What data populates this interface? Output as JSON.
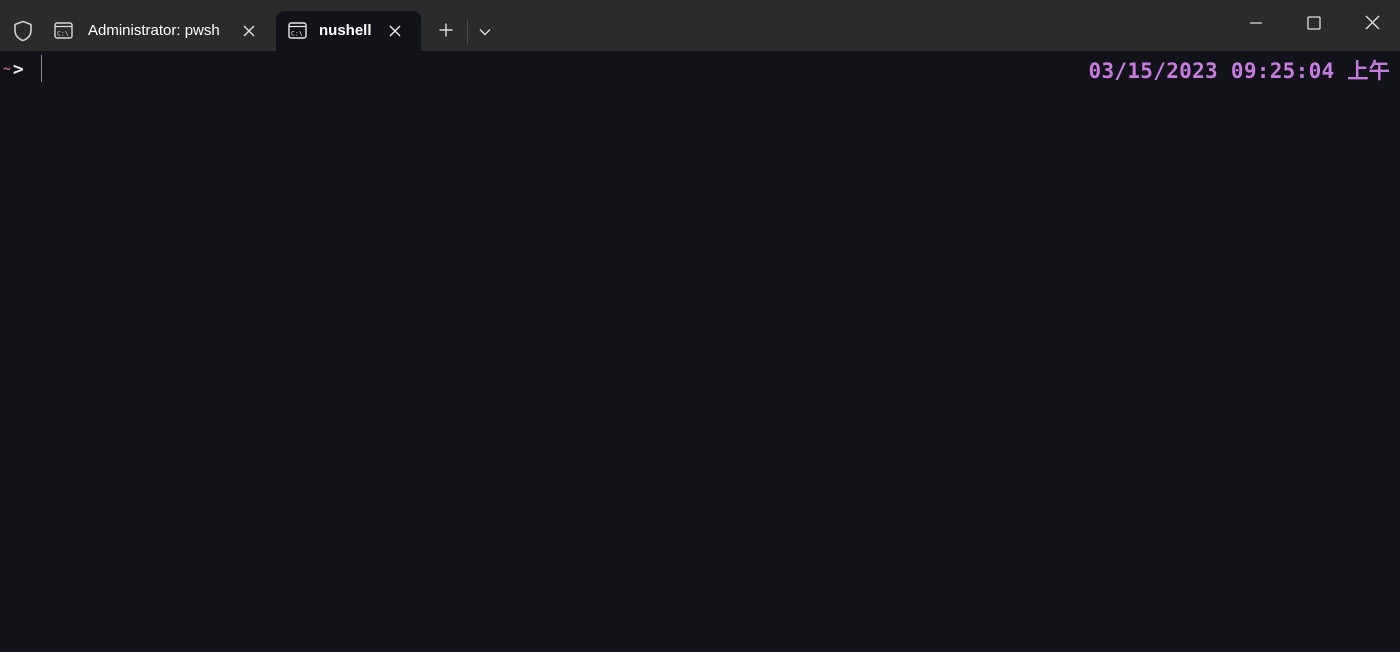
{
  "window": {
    "tabs": [
      {
        "label": "Administrator: pwsh",
        "icon": "console-icon",
        "active": false
      },
      {
        "label": "nushell",
        "icon": "console-icon",
        "active": true
      }
    ],
    "new_tab_icon": "plus-icon",
    "dropdown_icon": "chevron-down-icon",
    "shield_icon": "shield-icon",
    "controls": [
      "minimize-icon",
      "maximize-icon",
      "close-icon"
    ]
  },
  "terminal": {
    "prompt_dir": "~",
    "prompt_char": ">",
    "right_prompt": "03/15/2023 09:25:04 上午"
  },
  "colors": {
    "titlebar": "#2b2b2b",
    "terminal_bg": "#121318",
    "right_prompt": "#c77be0",
    "prompt_dir": "#c06a8a"
  }
}
